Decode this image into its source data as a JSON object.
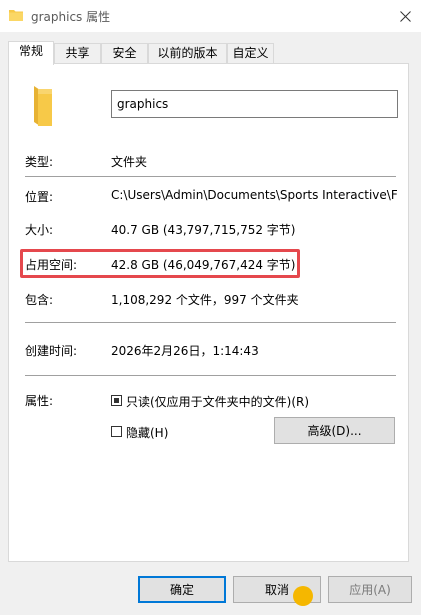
{
  "window": {
    "title": "graphics 属性"
  },
  "tabs": [
    {
      "label": "常规",
      "active": true
    },
    {
      "label": "共享"
    },
    {
      "label": "安全"
    },
    {
      "label": "以前的版本"
    },
    {
      "label": "自定义"
    }
  ],
  "general": {
    "name_value": "graphics",
    "type_label": "类型:",
    "type_value": "文件夹",
    "location_label": "位置:",
    "location_value": "C:\\Users\\Admin\\Documents\\Sports Interactive\\Fo",
    "size_label": "大小:",
    "size_value": "40.7 GB (43,797,715,752 字节)",
    "disk_label": "占用空间:",
    "disk_value": "42.8 GB (46,049,767,424 字节)",
    "contains_label": "包含:",
    "contains_value": "1,108,292 个文件，997 个文件夹",
    "created_label": "创建时间:",
    "created_value": "2026年2月26日，1:14:43",
    "attributes_label": "属性:",
    "readonly_label": "只读(仅应用于文件夹中的文件)(R)",
    "readonly_checked": true,
    "hidden_label": "隐藏(H)",
    "hidden_checked": false,
    "advanced_label": "高级(D)..."
  },
  "footer": {
    "ok_label": "确定",
    "cancel_label": "取消",
    "apply_label": "应用(A)"
  },
  "icons": [
    "folder-icon",
    "close-icon"
  ],
  "colors": {
    "highlight": "#e5484d",
    "folder": "#f7c948",
    "accent": "#0078d7"
  }
}
